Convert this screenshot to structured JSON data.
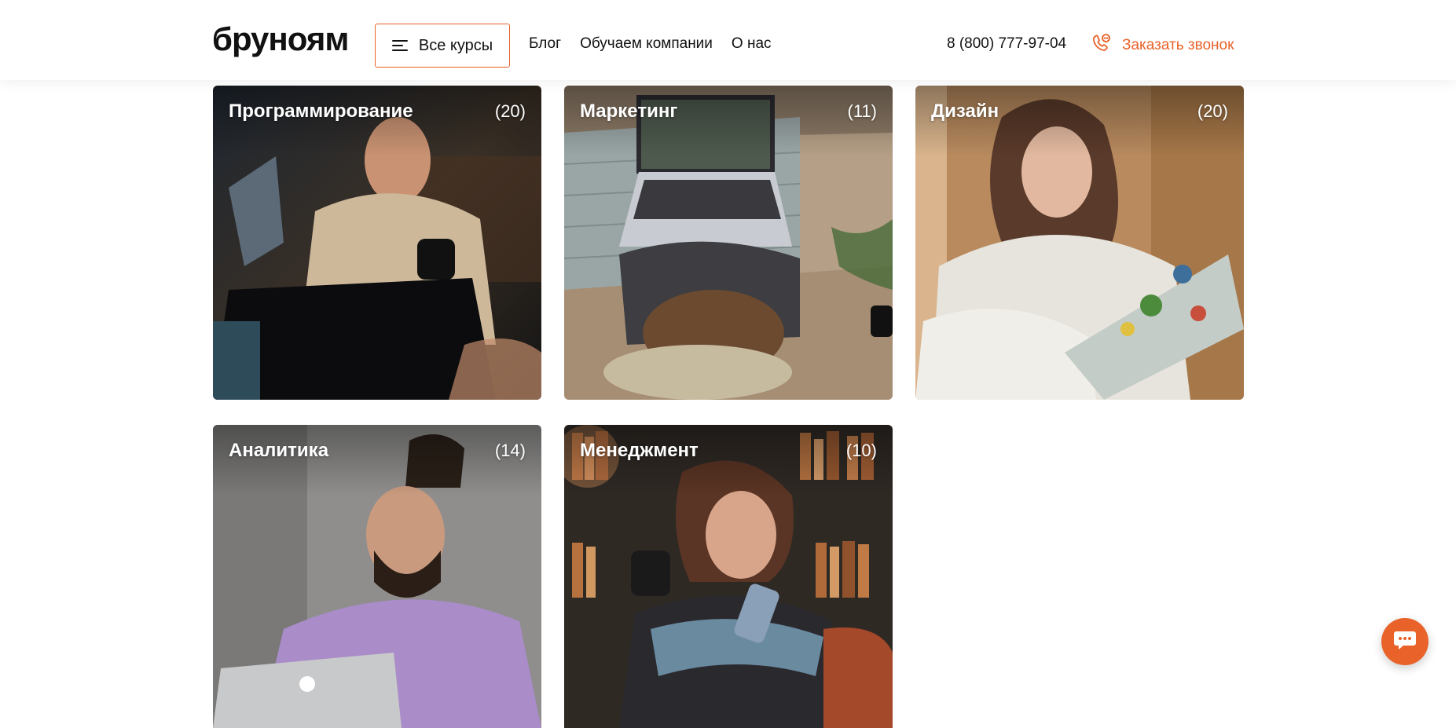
{
  "header": {
    "logo": "бруноям",
    "all_courses_label": "Все курсы",
    "nav": [
      "Блог",
      "Обучаем компании",
      "О нас"
    ],
    "phone": "8 (800) 777-97-04",
    "callback_label": "Заказать звонок"
  },
  "categories": [
    {
      "title": "Программирование",
      "count": "(20)"
    },
    {
      "title": "Маркетинг",
      "count": "(11)"
    },
    {
      "title": "Дизайн",
      "count": "(20)"
    },
    {
      "title": "Аналитика",
      "count": "(14)"
    },
    {
      "title": "Менеджмент",
      "count": "(10)"
    }
  ],
  "colors": {
    "accent": "#e8622a"
  },
  "icons": {
    "menu": "menu-icon",
    "phone": "phone-chat-icon",
    "chat": "chat-icon"
  }
}
